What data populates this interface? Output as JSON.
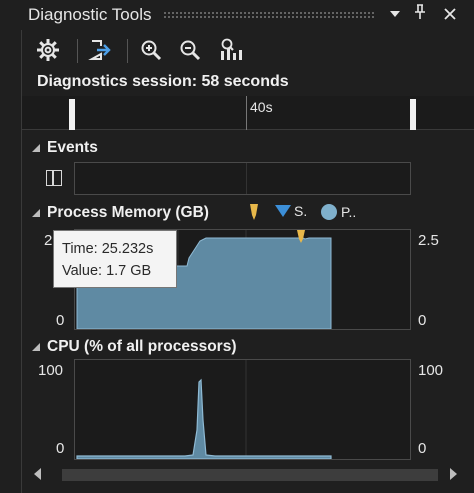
{
  "window": {
    "title": "Diagnostic Tools",
    "dropdown_icon": "dropdown-arrow-icon",
    "pin_icon": "pin-icon",
    "close_icon": "close-icon"
  },
  "toolbar": {
    "buttons": [
      {
        "name": "settings",
        "icon": "gear-icon"
      },
      {
        "name": "export",
        "icon": "export-icon"
      },
      {
        "name": "zoom-in",
        "icon": "zoom-in-icon"
      },
      {
        "name": "zoom-out",
        "icon": "zoom-out-icon"
      },
      {
        "name": "reset-view",
        "icon": "reset-zoom-icon"
      }
    ]
  },
  "session": {
    "label": "Diagnostics session: 58 seconds"
  },
  "ruler": {
    "tick_label": "40s"
  },
  "events": {
    "title": "Events"
  },
  "memory": {
    "title": "Process Memory (GB)",
    "legend": [
      {
        "label": "",
        "icon": "gc-marker-icon",
        "color": "#e8b84a"
      },
      {
        "label": "S.",
        "icon": "snapshot-marker-icon",
        "color": "#3c8fd8"
      },
      {
        "label": "P..",
        "icon": "private-bytes-icon",
        "color": "#7fb0cc"
      }
    ],
    "y_left_top": "2",
    "y_left_bottom": "0",
    "y_right_top": "2.5",
    "y_right_bottom": "0",
    "tooltip": {
      "time": "Time: 25.232s",
      "value": "Value: 1.7 GB"
    }
  },
  "cpu": {
    "title": "CPU (% of all processors)",
    "y_left_top": "100",
    "y_left_bottom": "0",
    "y_right_top": "100",
    "y_right_bottom": "0"
  },
  "colors": {
    "background": "#1f1f1f",
    "chart_fill": "#5f8aa3",
    "chart_line": "#8fbad4",
    "gc_marker": "#e8b84a",
    "snapshot_marker": "#3c8fd8"
  }
}
